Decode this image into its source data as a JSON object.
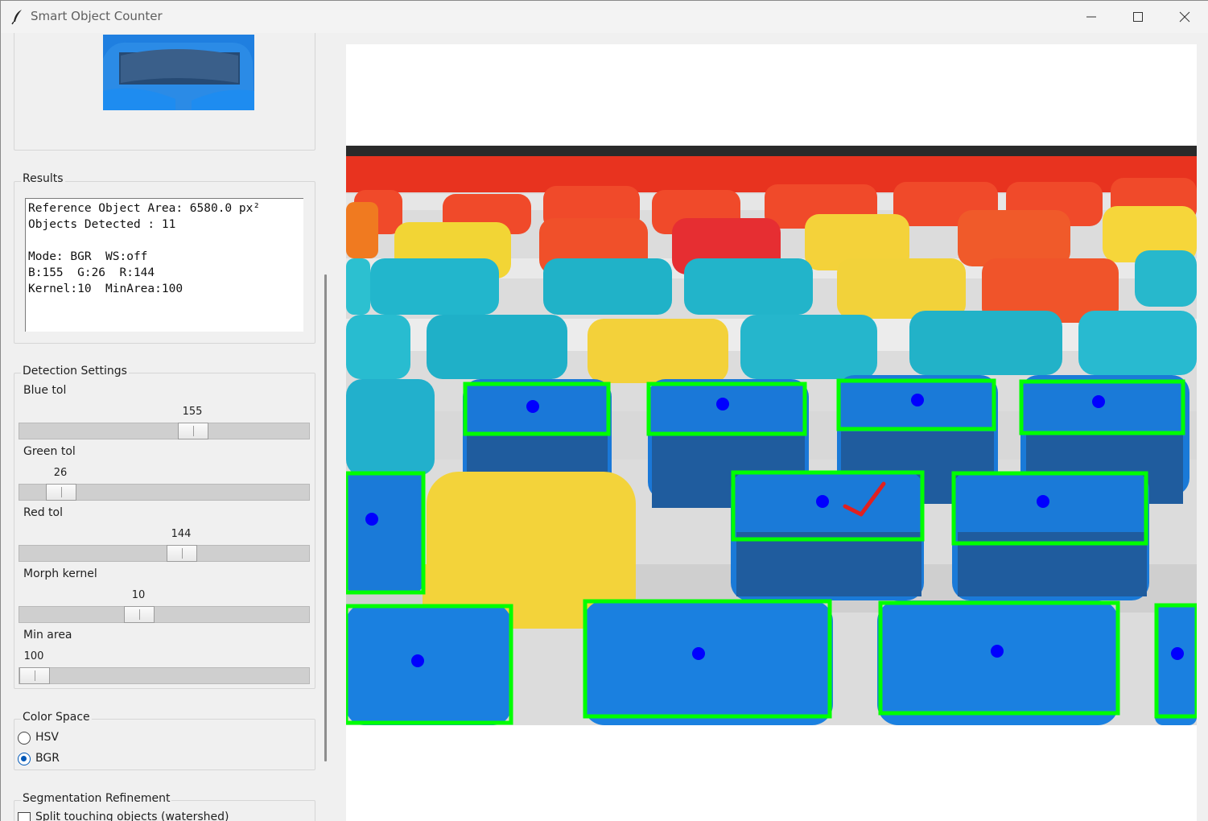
{
  "window": {
    "title": "Smart Object Counter"
  },
  "icons": {
    "app": "feather-icon",
    "minimize": "minimize-icon",
    "maximize": "maximize-icon",
    "close": "close-icon"
  },
  "results": {
    "label": "Results",
    "text": "Reference Object Area: 6580.0 px²\nObjects Detected : 11\n\nMode: BGR  WS:off\nB:155  G:26  R:144\nKernel:10  MinArea:100"
  },
  "detection": {
    "label": "Detection Settings",
    "sliders": [
      {
        "label": "Blue tol",
        "value": "155",
        "fraction": 0.608
      },
      {
        "label": "Green tol",
        "value": "26",
        "fraction": 0.102
      },
      {
        "label": "Red tol",
        "value": "144",
        "fraction": 0.565
      },
      {
        "label": "Morph kernel",
        "value": "10",
        "fraction": 0.4
      },
      {
        "label": "Min area",
        "value": "100",
        "fraction": 0.0
      }
    ]
  },
  "color_space": {
    "label": "Color Space",
    "options": [
      {
        "label": "HSV",
        "selected": false
      },
      {
        "label": "BGR",
        "selected": true
      }
    ]
  },
  "segmentation": {
    "label": "Segmentation Refinement",
    "checkbox_label": "Split touching objects (watershed)",
    "checked": false
  },
  "colors": {
    "accent": "#0058b8",
    "detection_box": "#00ff00",
    "centroid": "#0000ff",
    "check_mark": "#e02020",
    "seat_blue": "#1a7ad8"
  }
}
